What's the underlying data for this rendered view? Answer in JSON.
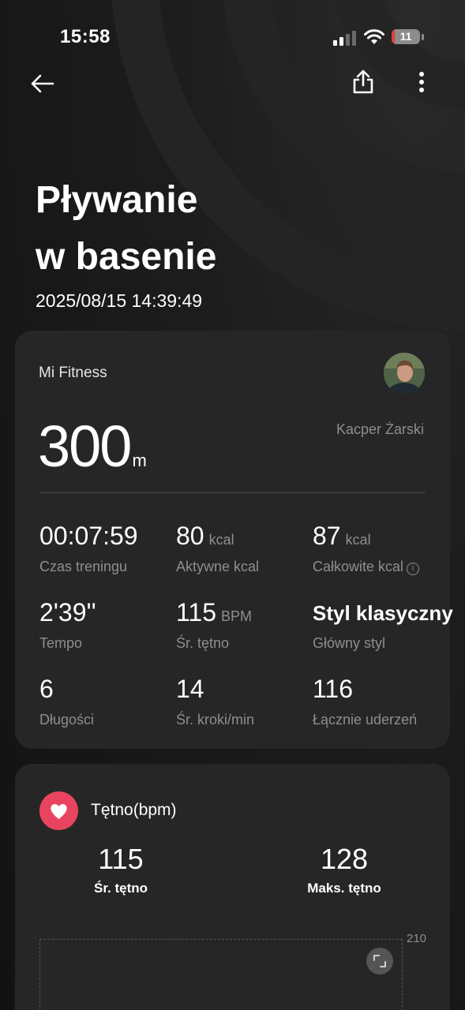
{
  "status_bar": {
    "time": "15:58",
    "battery_level": "11"
  },
  "header": {
    "title_line1": "Pływanie",
    "title_line2": "w basenie",
    "datetime": "2025/08/15 14:39:49"
  },
  "summary": {
    "source": "Mi Fitness",
    "user_name": "Kacper Żarski",
    "distance_value": "300",
    "distance_unit": "m",
    "stats": [
      {
        "value": "00:07:59",
        "unit": "",
        "label": "Czas treningu"
      },
      {
        "value": "80",
        "unit": "kcal",
        "label": "Aktywne kcal"
      },
      {
        "value": "87",
        "unit": "kcal",
        "label": "Całkowite kcal"
      },
      {
        "value": "2'39''",
        "unit": "",
        "label": "Tempo"
      },
      {
        "value": "115",
        "unit": "BPM",
        "label": "Śr. tętno"
      },
      {
        "value": "Styl klasyczny",
        "unit": "",
        "label": "Główny styl"
      },
      {
        "value": "6",
        "unit": "",
        "label": "Długości"
      },
      {
        "value": "14",
        "unit": "",
        "label": "Śr. kroki/min"
      },
      {
        "value": "116",
        "unit": "",
        "label": "Łącznie uderzeń"
      }
    ]
  },
  "heart_rate": {
    "title": "Tętno(bpm)",
    "avg_value": "115",
    "avg_label": "Śr. tętno",
    "max_value": "128",
    "max_label": "Maks. tętno",
    "chart_y_max": "210"
  },
  "colors": {
    "background": "#161616",
    "card": "#262626",
    "accent_heart": "#e9445f",
    "secondary_text": "#8e8e8e",
    "battery_low": "#e0403c"
  },
  "icons": {
    "back": "arrow-left-icon",
    "share": "share-icon",
    "more": "more-vertical-icon",
    "heart": "heart-icon",
    "expand": "expand-icon",
    "info": "info-icon"
  }
}
